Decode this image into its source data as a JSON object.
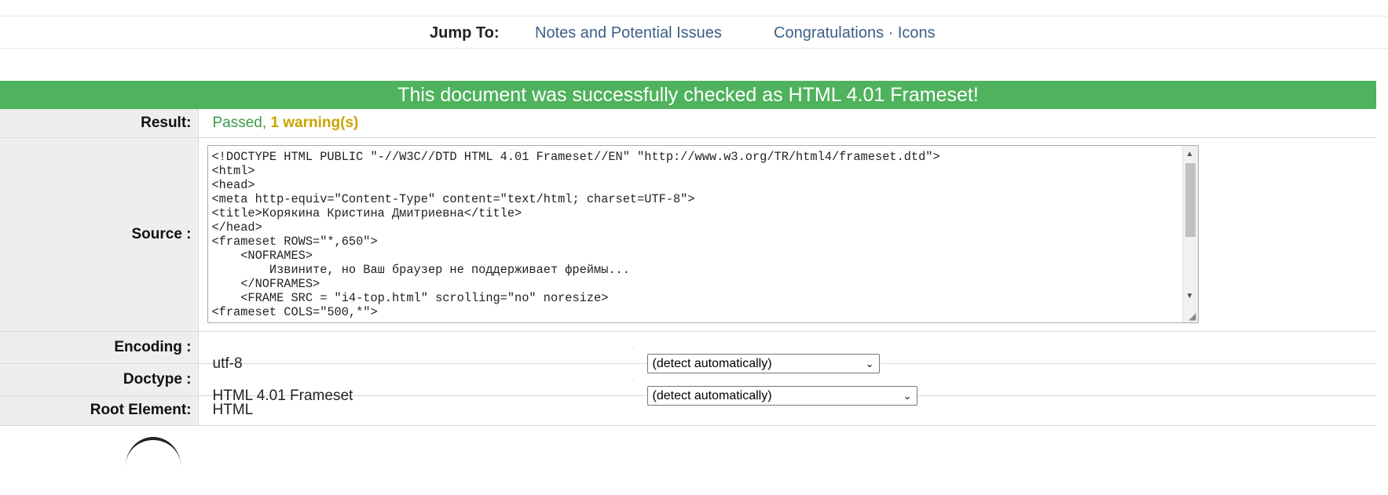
{
  "jump": {
    "label": "Jump To:",
    "links": [
      "Notes and Potential Issues",
      "Congratulations · Icons"
    ]
  },
  "banner": "This document was successfully checked as HTML 4.01 Frameset!",
  "result": {
    "label": "Result:",
    "passed": "Passed,",
    "warnings": "1 warning(s)"
  },
  "source": {
    "label": "Source :",
    "text": "<!DOCTYPE HTML PUBLIC \"-//W3C//DTD HTML 4.01 Frameset//EN\" \"http://www.w3.org/TR/html4/frameset.dtd\">\n<html>\n<head>\n<meta http-equiv=\"Content-Type\" content=\"text/html; charset=UTF-8\">\n<title>Корякина Кристина Дмитриевна</title>\n</head>\n<frameset ROWS=\"*,650\">\n    <NOFRAMES>\n        Извините, но Ваш браузер не поддерживает фреймы...\n    </NOFRAMES>\n    <FRAME SRC = \"i4-top.html\" scrolling=\"no\" noresize>\n<frameset COLS=\"500,*\">"
  },
  "encoding": {
    "label": "Encoding :",
    "value": "utf-8",
    "select": "(detect automatically)"
  },
  "doctype": {
    "label": "Doctype :",
    "value": "HTML 4.01 Frameset",
    "select": "(detect automatically)"
  },
  "root": {
    "label": "Root Element:",
    "value": "HTML"
  },
  "colors": {
    "banner": "#4fb25c",
    "passed": "#3e9a4a",
    "warning": "#c9a400",
    "link": "#3d5f87"
  }
}
